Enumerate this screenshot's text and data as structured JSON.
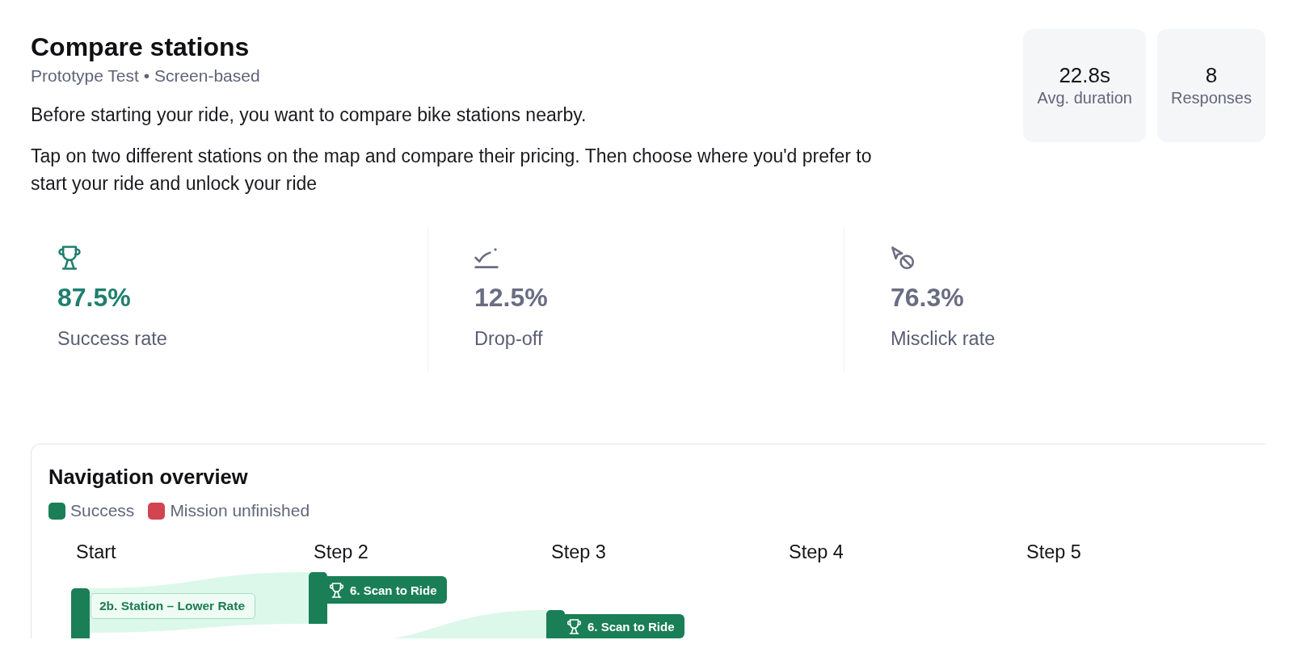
{
  "header": {
    "title": "Compare stations",
    "subtitle": "Prototype Test • Screen-based",
    "paragraphs": [
      "Before starting your ride, you want to compare bike stations nearby.",
      "Tap on two different stations on the map and compare their pricing. Then choose where you'd prefer to start your ride and unlock your ride"
    ]
  },
  "stats": [
    {
      "value": "22.8s",
      "label": "Avg. duration"
    },
    {
      "value": "8",
      "label": "Responses"
    }
  ],
  "metrics": [
    {
      "kind": "success",
      "value": "87.5%",
      "label": "Success rate"
    },
    {
      "kind": "drop_off",
      "value": "12.5%",
      "label": "Drop-off"
    },
    {
      "kind": "misclick",
      "value": "76.3%",
      "label": "Misclick rate"
    }
  ],
  "navigation_overview": {
    "title": "Navigation overview",
    "legend": [
      {
        "label": "Success",
        "color": "#1a7f56"
      },
      {
        "label": "Mission unfinished",
        "color": "#d2444f"
      }
    ],
    "steps": [
      {
        "label": "Start",
        "nodes": [
          {
            "kind": "screen",
            "label": "2b. Station – Lower Rate"
          }
        ]
      },
      {
        "label": "Step 2",
        "nodes": [
          {
            "kind": "success",
            "label": "6. Scan to Ride"
          }
        ]
      },
      {
        "label": "Step 3",
        "nodes": [
          {
            "kind": "success",
            "label": "6. Scan to Ride"
          }
        ]
      },
      {
        "label": "Step 4"
      },
      {
        "label": "Step 5"
      }
    ]
  }
}
